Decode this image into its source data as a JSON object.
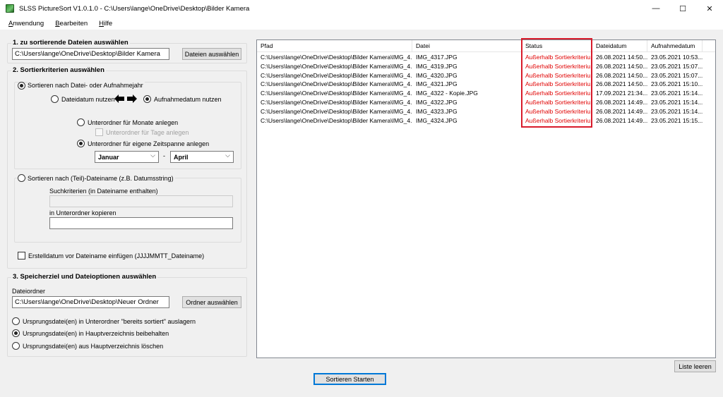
{
  "window": {
    "title": "SLSS PictureSort V1.0.1.0 - C:\\Users\\lange\\OneDrive\\Desktop\\Bilder Kamera",
    "min": "—",
    "max": "☐",
    "close": "✕"
  },
  "menu": [
    "Anwendung",
    "Bearbeiten",
    "Hilfe"
  ],
  "section1": {
    "title": "1. zu sortierende Dateien auswählen",
    "path": "C:\\Users\\lange\\OneDrive\\Desktop\\Bilder Kamera",
    "button": "Dateien auswählen"
  },
  "section2": {
    "title": "2. Sortierkriterien auswählen",
    "opt_date": "Sortieren nach Datei- oder Aufnahmejahr",
    "opt_file_date": "Dateidatum nutzen",
    "opt_capture_date": "Aufnahmedatum nutzen",
    "opt_months": "Unterordner für Monate anlegen",
    "opt_days": "Unterordner für Tage anlegen",
    "opt_custom": "Unterordner für eigene Zeitspanne anlegen",
    "month_from": "Januar",
    "separator": "-",
    "month_to": "April",
    "opt_name": "Sortieren nach (Teil)-Dateiname (z.B. Datumsstring)",
    "search_label": "Suchkriterien (in Dateiname enthalten)",
    "search_value": "",
    "copy_label": "in Unterordner kopieren",
    "copy_value": "",
    "opt_prefix": "Erstelldatum vor Dateiname einfügen (JJJJMMTT_Dateiname)"
  },
  "section3": {
    "title": "3. Speicherziel und Dateioptionen auswählen",
    "folder_label": "Dateiordner",
    "folder_path": "C:\\Users\\lange\\OneDrive\\Desktop\\Neuer Ordner",
    "button": "Ordner auswählen",
    "opt_move": "Ursprungsdatei(en) in Unterordner \"bereits sortiert\" auslagern",
    "opt_keep": "Ursprungsdatei(en) in Hauptverzeichnis beibehalten",
    "opt_delete": "Ursprungsdatei(en) aus Hauptverzeichnis löschen"
  },
  "table": {
    "columns": [
      "Pfad",
      "Datei",
      "Status",
      "Dateidatum",
      "Aufnahmedatum"
    ],
    "rows": [
      [
        "C:\\Users\\lange\\OneDrive\\Desktop\\Bilder Kamera\\IMG_4...",
        "IMG_4317.JPG",
        "Außerhalb Sortierkriteriu...",
        "26.08.2021 14:50...",
        "23.05.2021 10:53..."
      ],
      [
        "C:\\Users\\lange\\OneDrive\\Desktop\\Bilder Kamera\\IMG_4...",
        "IMG_4319.JPG",
        "Außerhalb Sortierkriteriu...",
        "26.08.2021 14:50...",
        "23.05.2021 15:07..."
      ],
      [
        "C:\\Users\\lange\\OneDrive\\Desktop\\Bilder Kamera\\IMG_4...",
        "IMG_4320.JPG",
        "Außerhalb Sortierkriteriu...",
        "26.08.2021 14:50...",
        "23.05.2021 15:07..."
      ],
      [
        "C:\\Users\\lange\\OneDrive\\Desktop\\Bilder Kamera\\IMG_4...",
        "IMG_4321.JPG",
        "Außerhalb Sortierkriteriu...",
        "26.08.2021 14:50...",
        "23.05.2021 15:10..."
      ],
      [
        "C:\\Users\\lange\\OneDrive\\Desktop\\Bilder Kamera\\IMG_4...",
        "IMG_4322 - Kopie.JPG",
        "Außerhalb Sortierkriteriu...",
        "17.09.2021 21:34...",
        "23.05.2021 15:14..."
      ],
      [
        "C:\\Users\\lange\\OneDrive\\Desktop\\Bilder Kamera\\IMG_4...",
        "IMG_4322.JPG",
        "Außerhalb Sortierkriteriu...",
        "26.08.2021 14:49...",
        "23.05.2021 15:14..."
      ],
      [
        "C:\\Users\\lange\\OneDrive\\Desktop\\Bilder Kamera\\IMG_4...",
        "IMG_4323.JPG",
        "Außerhalb Sortierkriteriu...",
        "26.08.2021 14:49...",
        "23.05.2021 15:14..."
      ],
      [
        "C:\\Users\\lange\\OneDrive\\Desktop\\Bilder Kamera\\IMG_4...",
        "IMG_4324.JPG",
        "Außerhalb Sortierkriteriu...",
        "26.08.2021 14:49...",
        "23.05.2021 15:15..."
      ]
    ]
  },
  "buttons": {
    "clear_list": "Liste leeren",
    "start": "Sortieren Starten"
  },
  "colors": {
    "status_error": "#e00000",
    "highlight": "#d81b2b",
    "accent": "#0078d7"
  }
}
